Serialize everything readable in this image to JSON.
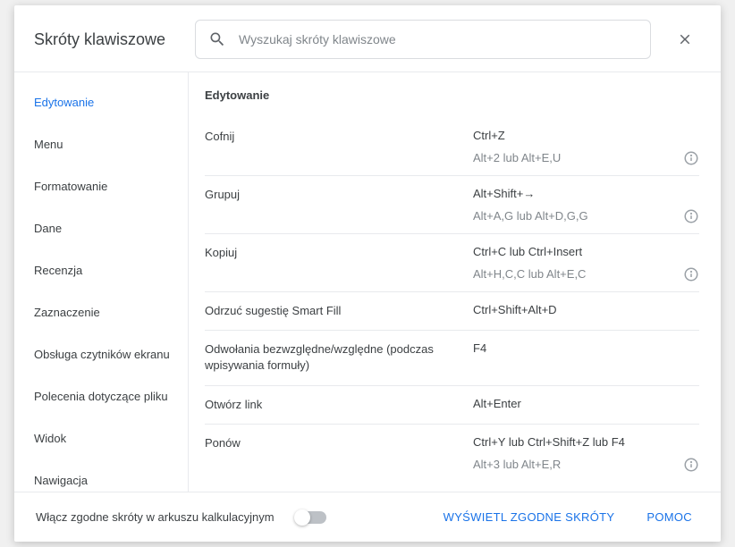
{
  "dialog": {
    "title": "Skróty klawiszowe",
    "search_placeholder": "Wyszukaj skróty klawiszowe"
  },
  "sidebar": {
    "items": [
      {
        "label": "Edytowanie",
        "active": true
      },
      {
        "label": "Menu",
        "active": false
      },
      {
        "label": "Formatowanie",
        "active": false
      },
      {
        "label": "Dane",
        "active": false
      },
      {
        "label": "Recenzja",
        "active": false
      },
      {
        "label": "Zaznaczenie",
        "active": false
      },
      {
        "label": "Obsługa czytników ekranu",
        "active": false
      },
      {
        "label": "Polecenia dotyczące pliku",
        "active": false
      },
      {
        "label": "Widok",
        "active": false
      },
      {
        "label": "Nawigacja",
        "active": false
      }
    ]
  },
  "content": {
    "section_title": "Edytowanie",
    "rows": [
      {
        "cmd": "Cofnij",
        "keys": "Ctrl+Z",
        "alt": "Alt+2 lub Alt+E,U",
        "info": true
      },
      {
        "cmd": "Grupuj",
        "keys": "Alt+Shift+→",
        "alt": "Alt+A,G lub Alt+D,G,G",
        "info": true
      },
      {
        "cmd": "Kopiuj",
        "keys": "Ctrl+C lub Ctrl+Insert",
        "alt": "Alt+H,C,C lub Alt+E,C",
        "info": true
      },
      {
        "cmd": "Odrzuć sugestię Smart Fill",
        "keys": "Ctrl+Shift+Alt+D",
        "alt": null,
        "info": false
      },
      {
        "cmd": "Odwołania bezwzględne/względne (podczas wpisywania formuły)",
        "keys": "F4",
        "alt": null,
        "info": false
      },
      {
        "cmd": "Otwórz link",
        "keys": "Alt+Enter",
        "alt": null,
        "info": false
      },
      {
        "cmd": "Ponów",
        "keys": "Ctrl+Y lub Ctrl+Shift+Z lub F4",
        "alt": "Alt+3 lub Alt+E,R",
        "info": true
      }
    ]
  },
  "footer": {
    "toggle_label": "Włącz zgodne skróty w arkuszu kalkulacyjnym",
    "view_compatible": "WYŚWIETL ZGODNE SKRÓTY",
    "help": "POMOC"
  }
}
